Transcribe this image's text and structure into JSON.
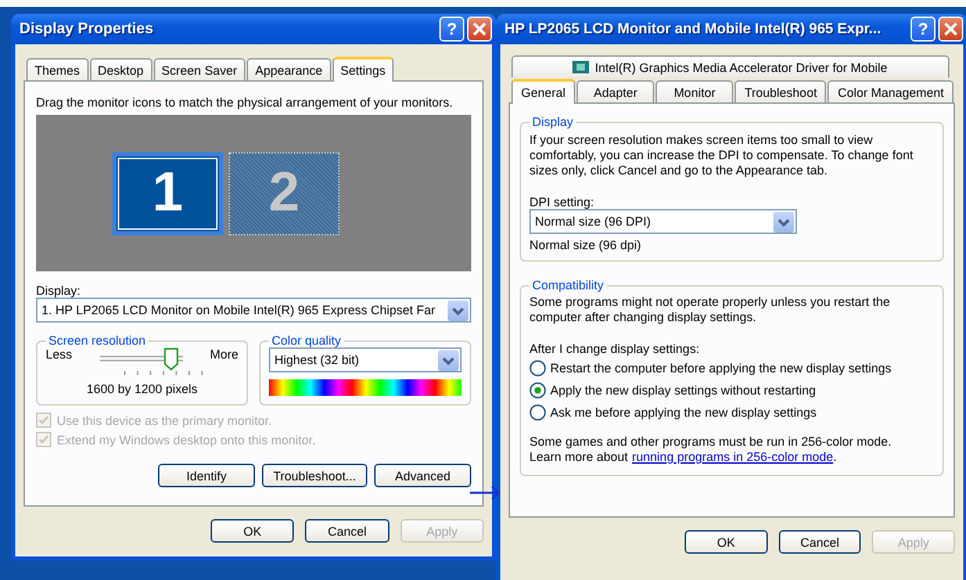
{
  "display_properties": {
    "title": "Display Properties",
    "help_button": "?",
    "tabs": [
      {
        "label": "Themes",
        "selected": false
      },
      {
        "label": "Desktop",
        "selected": false
      },
      {
        "label": "Screen Saver",
        "selected": false
      },
      {
        "label": "Appearance",
        "selected": false
      },
      {
        "label": "Settings",
        "selected": true
      }
    ],
    "instruction": "Drag the monitor icons to match the physical arrangement of your monitors.",
    "monitors": [
      {
        "number": "1",
        "selected": true
      },
      {
        "number": "2",
        "selected": false
      }
    ],
    "display": {
      "label": "Display:",
      "value": "1. HP LP2065 LCD Monitor on Mobile Intel(R) 965 Express Chipset Far"
    },
    "screen_resolution": {
      "title": "Screen resolution",
      "less": "Less",
      "more": "More",
      "level": 0.95,
      "reading": "1600 by 1200 pixels"
    },
    "color_quality": {
      "title": "Color quality",
      "value": "Highest (32 bit)"
    },
    "checkboxes": [
      {
        "label": "Use this device as the primary monitor.",
        "checked": true,
        "disabled": true
      },
      {
        "label": "Extend my Windows desktop onto this monitor.",
        "checked": true,
        "disabled": true
      }
    ],
    "buttons": [
      {
        "label": "Identify",
        "disabled": false
      },
      {
        "label": "Troubleshoot...",
        "disabled": false
      },
      {
        "label": "Advanced",
        "disabled": false
      }
    ],
    "footer_buttons": [
      {
        "label": "OK",
        "disabled": false
      },
      {
        "label": "Cancel",
        "disabled": false
      },
      {
        "label": "Apply",
        "disabled": true
      }
    ]
  },
  "advanced_properties": {
    "title": "HP LP2065 LCD Monitor and Mobile Intel(R) 965 Expr...",
    "help_button": "?",
    "top_tab": {
      "label": "Intel(R) Graphics Media Accelerator Driver for Mobile",
      "selected": false
    },
    "tabs": [
      {
        "label": "General",
        "selected": true
      },
      {
        "label": "Adapter",
        "selected": false
      },
      {
        "label": "Monitor",
        "selected": false
      },
      {
        "label": "Troubleshoot",
        "selected": false
      },
      {
        "label": "Color Management",
        "selected": false
      }
    ],
    "display_group": {
      "title": "Display",
      "text": "If your screen resolution makes screen items too small to view comfortably, you can increase the DPI to compensate.  To change font sizes only, click Cancel and go to the Appearance tab.",
      "dpi_label": "DPI setting:",
      "dpi_value": "Normal size (96 DPI)",
      "dpi_note": "Normal size (96 dpi)"
    },
    "compatibility": {
      "title": "Compatibility",
      "text": "Some programs might not operate properly unless you restart the computer after changing display settings.",
      "question": "After I change display settings:",
      "options": [
        {
          "label": "Restart the computer before applying the new display settings",
          "selected": false
        },
        {
          "label": "Apply the new display settings without restarting",
          "selected": true
        },
        {
          "label": "Ask me before applying the new display settings",
          "selected": false
        }
      ],
      "note": "Some games and other programs must be run in 256-color mode.",
      "learn_prefix": "Learn more about",
      "link": "running programs in 256-color mode",
      "learn_suffix": "."
    },
    "footer_buttons": [
      {
        "label": "OK",
        "disabled": false
      },
      {
        "label": "Cancel",
        "disabled": false
      },
      {
        "label": "Apply",
        "disabled": true
      }
    ]
  }
}
